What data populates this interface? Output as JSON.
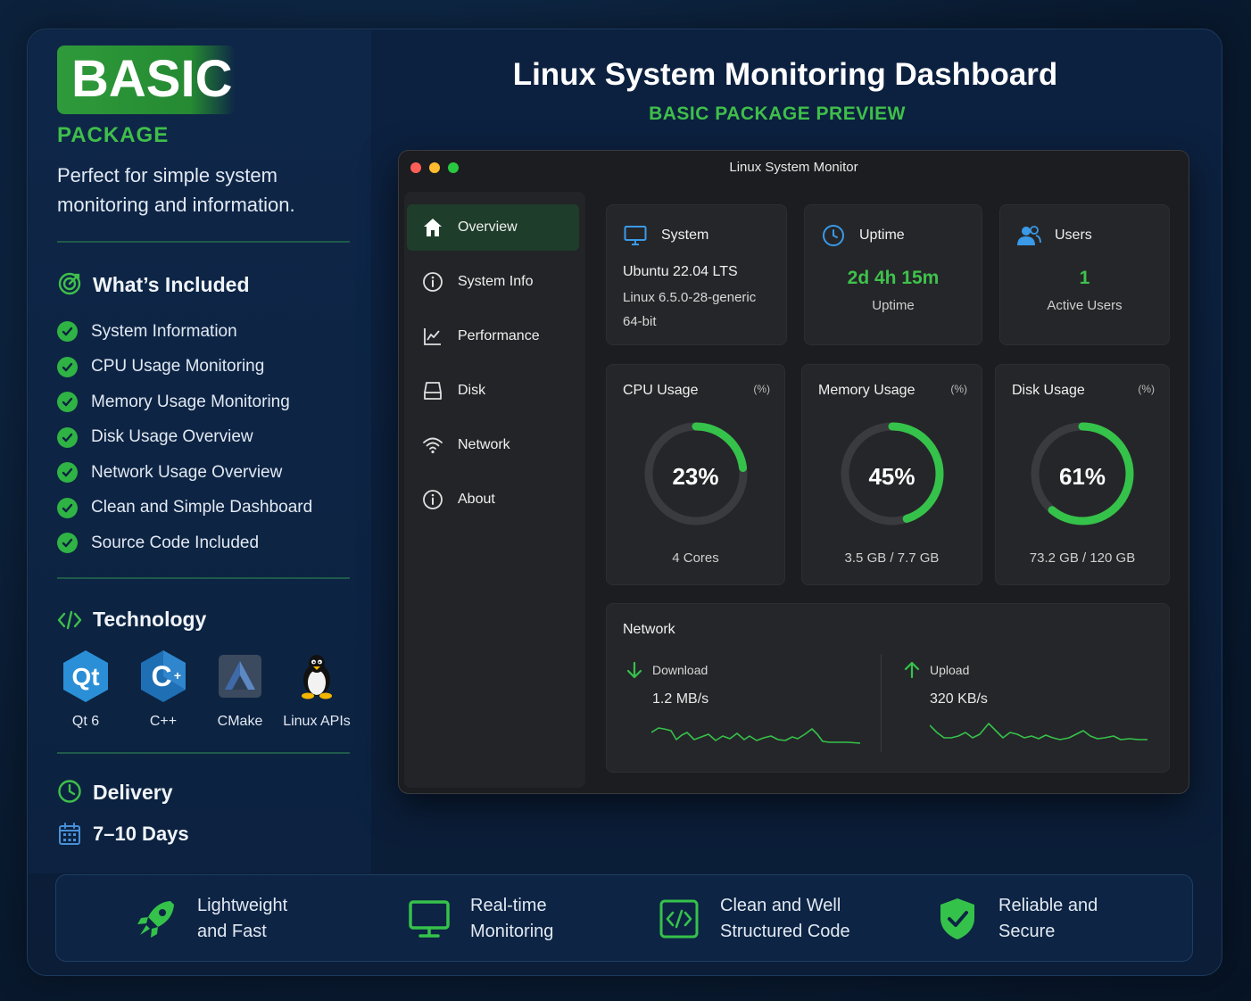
{
  "sidebar_panel": {
    "badge": "BASIC",
    "package_label": "PACKAGE",
    "description": "Perfect for simple system monitoring and information.",
    "included": {
      "title": "What’s Included",
      "items": [
        "System Information",
        "CPU Usage Monitoring",
        "Memory Usage Monitoring",
        "Disk Usage Overview",
        "Network Usage Overview",
        "Clean and Simple Dashboard",
        "Source Code Included"
      ]
    },
    "technology": {
      "title": "Technology",
      "items": [
        {
          "label": "Qt 6",
          "icon": "qt-logo-icon",
          "logo_text": "Qt"
        },
        {
          "label": "C++",
          "icon": "cpp-logo-icon",
          "logo_text": "C"
        },
        {
          "label": "CMake",
          "icon": "cmake-logo-icon"
        },
        {
          "label": "Linux APIs",
          "icon": "linux-tux-icon"
        }
      ]
    },
    "delivery": {
      "title": "Delivery",
      "value": "7–10 Days"
    }
  },
  "header": {
    "title": "Linux System Monitoring Dashboard",
    "subtitle": "BASIC PACKAGE PREVIEW"
  },
  "window": {
    "title": "Linux System Monitor",
    "nav": [
      {
        "label": "Overview",
        "icon": "home-icon",
        "active": true
      },
      {
        "label": "System Info",
        "icon": "info-icon",
        "active": false
      },
      {
        "label": "Performance",
        "icon": "chart-icon",
        "active": false
      },
      {
        "label": "Disk",
        "icon": "disk-icon",
        "active": false
      },
      {
        "label": "Network",
        "icon": "wifi-icon",
        "active": false
      },
      {
        "label": "About",
        "icon": "info-icon",
        "active": false
      }
    ],
    "system_card": {
      "title": "System",
      "os": "Ubuntu 22.04 LTS",
      "kernel": "Linux 6.5.0-28-generic",
      "arch": "64-bit"
    },
    "uptime_card": {
      "title": "Uptime",
      "value": "2d 4h 15m",
      "caption": "Uptime"
    },
    "users_card": {
      "title": "Users",
      "value": "1",
      "caption": "Active Users"
    },
    "gauges": [
      {
        "title": "CPU Usage",
        "unit": "(%)",
        "percent": 23,
        "value_label": "23%",
        "caption": "4 Cores"
      },
      {
        "title": "Memory Usage",
        "unit": "(%)",
        "percent": 45,
        "value_label": "45%",
        "caption": "3.5 GB / 7.7 GB"
      },
      {
        "title": "Disk Usage",
        "unit": "(%)",
        "percent": 61,
        "value_label": "61%",
        "caption": "73.2 GB / 120 GB"
      }
    ],
    "network_card": {
      "title": "Network",
      "download_label": "Download",
      "download_value": "1.2 MB/s",
      "upload_label": "Upload",
      "upload_value": "320 KB/s"
    }
  },
  "features": [
    {
      "line1": "Lightweight",
      "line2": "and Fast",
      "icon": "rocket-icon"
    },
    {
      "line1": "Real-time",
      "line2": "Monitoring",
      "icon": "monitor-icon"
    },
    {
      "line1": "Clean and Well",
      "line2": "Structured Code",
      "icon": "code-icon"
    },
    {
      "line1": "Reliable and",
      "line2": "Secure",
      "icon": "shield-check-icon"
    }
  ],
  "colors": {
    "accent_green": "#3fbf4a",
    "gauge_track": "#3a3b3f",
    "window_bg": "#1c1d20",
    "card_bg": "#252629",
    "active_nav": "#1e3d2a",
    "dot_red": "#ff5f57",
    "dot_yellow": "#febc2e",
    "dot_green": "#28c840"
  }
}
